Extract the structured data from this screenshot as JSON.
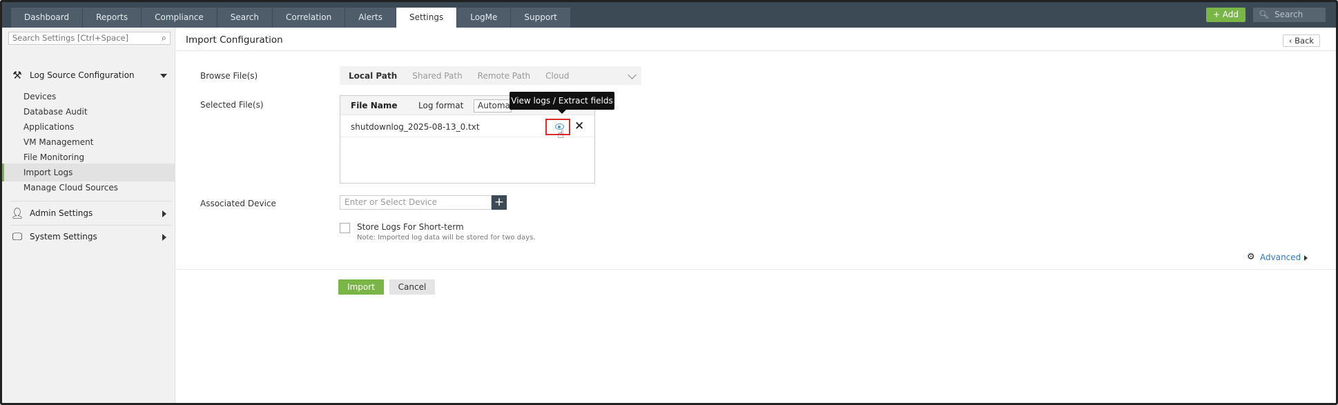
{
  "topbar": {
    "tabs": [
      "Dashboard",
      "Reports",
      "Compliance",
      "Search",
      "Correlation",
      "Alerts",
      "Settings",
      "LogMe",
      "Support"
    ],
    "active_tab": "Settings",
    "add_label": "+ Add",
    "search_placeholder": "Search"
  },
  "sidebar": {
    "search_placeholder": "Search Settings [Ctrl+Space]",
    "log_source_group": "Log Source Configuration",
    "items": [
      "Devices",
      "Database Audit",
      "Applications",
      "VM Management",
      "File Monitoring",
      "Import Logs",
      "Manage Cloud Sources"
    ],
    "active_item": "Import Logs",
    "admin_group": "Admin Settings",
    "system_group": "System Settings"
  },
  "main": {
    "title": "Import Configuration",
    "back_label": "Back",
    "browse_label": "Browse File(s)",
    "browse_tabs": [
      "Local Path",
      "Shared Path",
      "Remote Path",
      "Cloud"
    ],
    "selected_label": "Selected File(s)",
    "file_table": {
      "col_name": "File Name",
      "col_format": "Log format",
      "format_value": "Automatic",
      "file": "shutdownlog_2025-08-13_0.txt"
    },
    "tooltip": "View logs / Extract fields",
    "associated_label": "Associated Device",
    "device_placeholder": "Enter or Select Device",
    "store_label": "Store Logs For Short-term",
    "store_note": "Note: Imported log data will be stored for two days.",
    "advanced_label": "Advanced",
    "import_label": "Import",
    "cancel_label": "Cancel"
  }
}
